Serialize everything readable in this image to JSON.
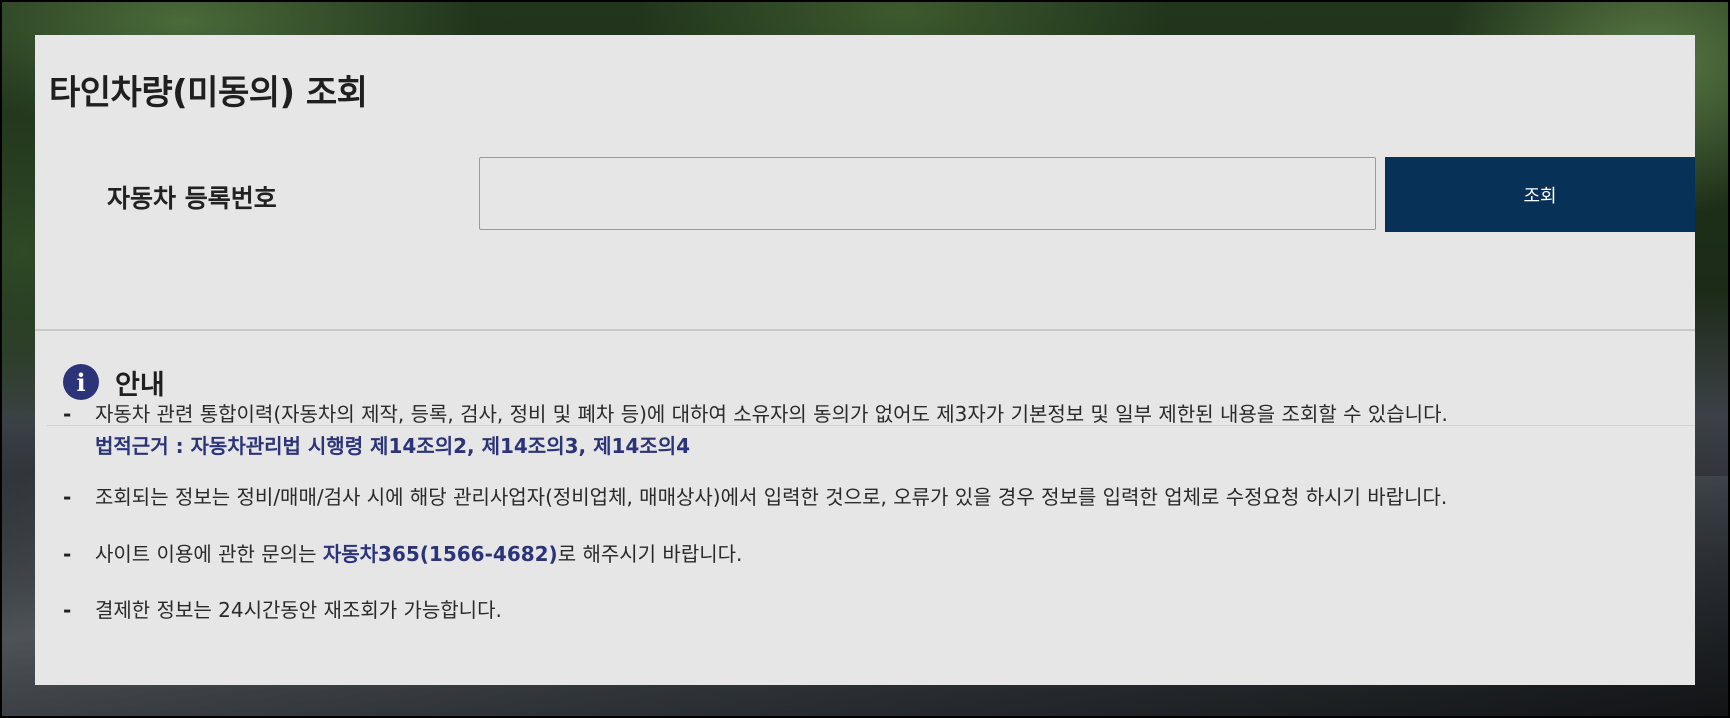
{
  "page": {
    "title": "타인차량(미동의) 조회"
  },
  "search": {
    "label": "자동차 등록번호",
    "value": "",
    "placeholder": "",
    "button_label": "조회",
    "button_color": "#073157"
  },
  "notice": {
    "icon": "info-icon",
    "icon_glyph": "i",
    "title": "안내",
    "dash": "-",
    "item1": {
      "text": "자동차 관련 통합이력(자동차의 제작, 등록, 검사, 정비 및 폐차 등)에 대하여 소유자의 동의가 없어도 제3자가 기본정보 및 일부 제한된 내용을 조회할 수 있습니다.",
      "legal_label": "법적근거 : ",
      "legal_text": "자동차관리법 시행령 제14조의2, 제14조의3, 제14조의4"
    },
    "item2": {
      "text": "조회되는 정보는 정비/매매/검사 시에 해당 관리사업자(정비업체, 매매상사)에서 입력한 것으로, 오류가 있을 경우 정보를 입력한 업체로 수정요청 하시기 바랍니다."
    },
    "item3": {
      "prefix": "사이트 이용에 관한 문의는 ",
      "highlight": "자동차365(1566-4682)",
      "suffix": "로 해주시기 바랍니다."
    },
    "item4": {
      "text": "결제한 정보는 24시간동안 재조회가 가능합니다."
    }
  },
  "colors": {
    "accent": "#2c3479",
    "panel_background": "#e6e6e6"
  }
}
